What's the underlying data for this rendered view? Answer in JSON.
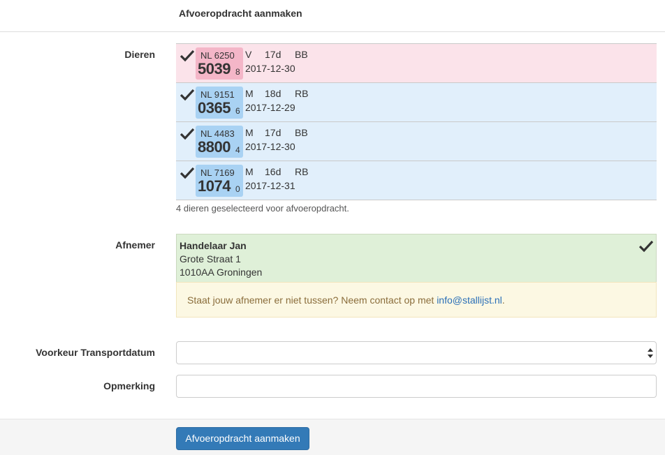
{
  "header": {
    "title": "Afvoeropdracht aanmaken"
  },
  "labels": {
    "animals": "Dieren",
    "buyer": "Afnemer",
    "transport_date": "Voorkeur Transportdatum",
    "remark": "Opmerking"
  },
  "animals": [
    {
      "country": "NL 6250",
      "number": "5039",
      "check_digit": "8",
      "sex": "V",
      "age": "17d",
      "breed": "BB",
      "date": "2017-12-30",
      "gender": "female"
    },
    {
      "country": "NL 9151",
      "number": "0365",
      "check_digit": "6",
      "sex": "M",
      "age": "18d",
      "breed": "RB",
      "date": "2017-12-29",
      "gender": "male"
    },
    {
      "country": "NL 4483",
      "number": "8800",
      "check_digit": "4",
      "sex": "M",
      "age": "17d",
      "breed": "BB",
      "date": "2017-12-30",
      "gender": "male"
    },
    {
      "country": "NL 7169",
      "number": "1074",
      "check_digit": "0",
      "sex": "M",
      "age": "16d",
      "breed": "RB",
      "date": "2017-12-31",
      "gender": "male"
    }
  ],
  "selected_note": "4 dieren geselecteerd voor afvoeropdracht.",
  "buyer": {
    "name": "Handelaar Jan",
    "street": "Grote Straat 1",
    "city": "1010AA Groningen"
  },
  "notice": {
    "text": "Staat jouw afnemer er niet tussen? Neem contact op met ",
    "email": "info@stallijst.nl",
    "suffix": "."
  },
  "form": {
    "transport_date_value": "",
    "remark_value": ""
  },
  "submit_label": "Afvoeropdracht aanmaken",
  "colors": {
    "female_bg": "#fbe3ea",
    "female_tag": "#f4b6c8",
    "male_bg": "#e1effb",
    "male_tag": "#a9d2f3",
    "buyer_bg": "#dff0d8",
    "notice_bg": "#fcf8e3",
    "primary": "#337ab7"
  }
}
